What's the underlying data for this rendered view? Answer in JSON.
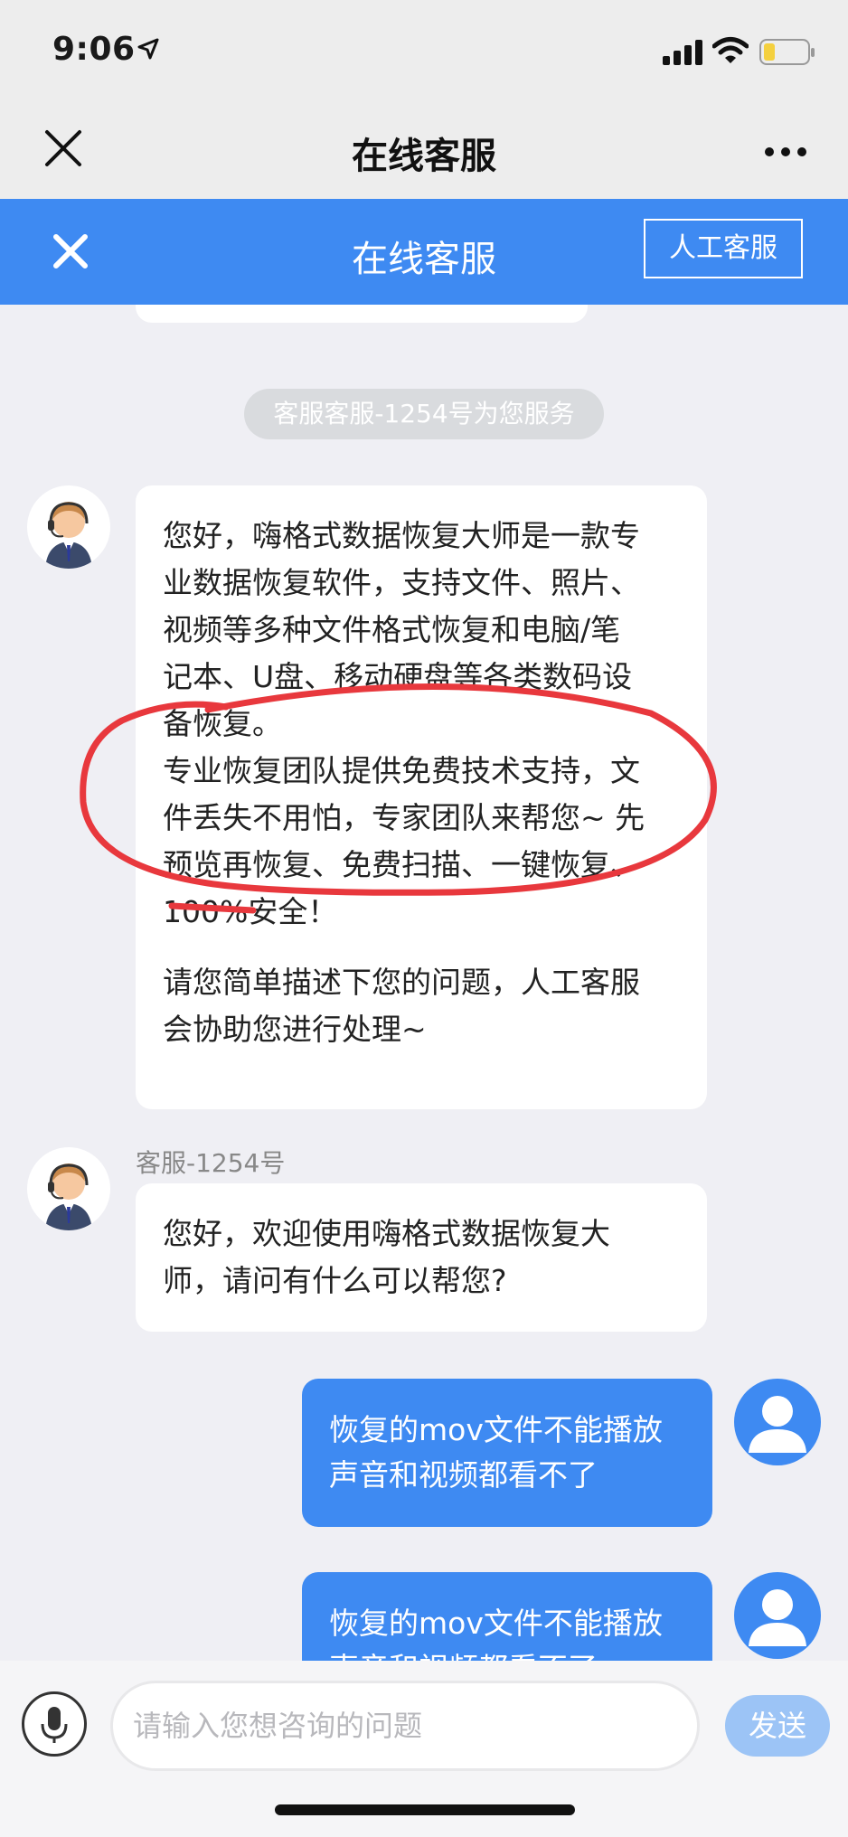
{
  "status_bar": {
    "time": "9:06",
    "icons": [
      "location-arrow-icon",
      "signal-icon",
      "wifi-icon",
      "battery-icon"
    ]
  },
  "nav": {
    "title": "在线客服",
    "left_icon": "close-icon",
    "right_icon": "more-icon"
  },
  "header": {
    "title": "在线客服",
    "close_icon": "close-icon",
    "agent_button": "人工客服",
    "color": "#3e8af2"
  },
  "chat": {
    "system_notice": "客服客服-1254号为您服务",
    "messages": [
      {
        "from": "agent",
        "paragraphs": [
          "您好，嗨格式数据恢复大师是一款专\n业数据恢复软件，支持文件、照片、\n视频等多种文件格式恢复和电脑/笔\n记本、U盘、移动硬盘等各类数码设\n备恢复。\n专业恢复团队提供免费技术支持，文\n件丢失不用怕，专家团队来帮您~ 先\n预览再恢复、免费扫描、一键恢复、\n100%安全！",
          "请您简单描述下您的问题，人工客服\n会协助您进行处理~"
        ]
      },
      {
        "from": "agent",
        "sender_name": "客服-1254号",
        "text": "您好，欢迎使用嗨格式数据恢复大\n师，请问有什么可以帮您?"
      },
      {
        "from": "user",
        "text": "恢复的mov文件不能播放\n声音和视频都看不了"
      },
      {
        "from": "user",
        "text": "恢复的mov文件不能播放\n声音和视频都看不了"
      }
    ]
  },
  "input_bar": {
    "mic_icon": "microphone-icon",
    "placeholder": "请输入您想咨询的问题",
    "send_label": "发送"
  }
}
